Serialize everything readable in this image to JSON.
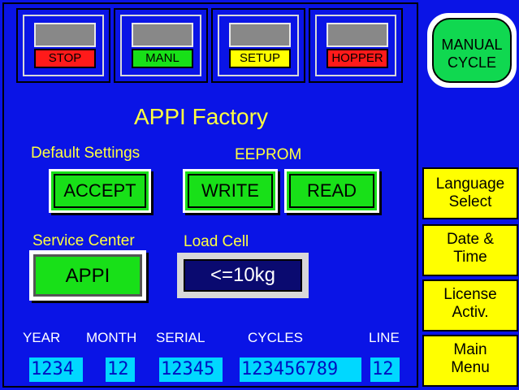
{
  "status_tiles": [
    {
      "label": "STOP",
      "tag_bg": "#ff1a1a",
      "tag_fg": "#000000"
    },
    {
      "label": "MANL",
      "tag_bg": "#18e018",
      "tag_fg": "#000000"
    },
    {
      "label": "SETUP",
      "tag_bg": "#ffff00",
      "tag_fg": "#000000"
    },
    {
      "label": "HOPPER",
      "tag_bg": "#ff1a1a",
      "tag_fg": "#000000"
    }
  ],
  "manual_cycle": {
    "line1": "MANUAL",
    "line2": "CYCLE"
  },
  "title": "APPI Factory",
  "default_settings": {
    "label": "Default Settings",
    "accept": "ACCEPT"
  },
  "eeprom": {
    "label": "EEPROM",
    "write": "WRITE",
    "read": "READ"
  },
  "service_center": {
    "label": "Service Center",
    "button": "APPI"
  },
  "load_cell": {
    "label": "Load Cell",
    "value": "<=10kg"
  },
  "side_menu": [
    {
      "line1": "Language",
      "line2": "Select"
    },
    {
      "line1": "Date &",
      "line2": "Time"
    },
    {
      "line1": "License",
      "line2": "Activ."
    },
    {
      "line1": "Main",
      "line2": "Menu"
    }
  ],
  "fields": {
    "year": {
      "label": "YEAR",
      "value": "1234"
    },
    "month": {
      "label": "MONTH",
      "value": "12"
    },
    "serial": {
      "label": "SERIAL",
      "value": "12345"
    },
    "cycles": {
      "label": "CYCLES",
      "value": "123456789"
    },
    "line": {
      "label": "LINE",
      "value": "12"
    }
  },
  "colors": {
    "background": "#0a14e6",
    "accent_yellow": "#ffff40",
    "button_green": "#18e018",
    "field_cyan": "#00d8ff"
  }
}
